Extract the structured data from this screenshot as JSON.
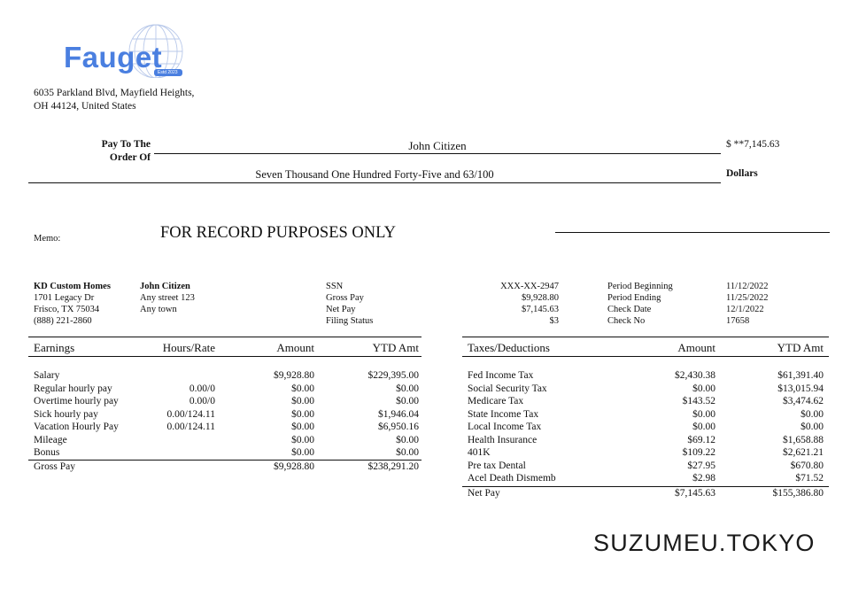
{
  "company": {
    "logo_name": "Fauget",
    "logo_estd": "Estd 2023",
    "address_line1": "6035 Parkland Blvd, Mayfield Heights,",
    "address_line2": "OH 44124, United States"
  },
  "check": {
    "pay_to_label_1": "Pay To The",
    "pay_to_label_2": "Order Of",
    "payee": "John Citizen",
    "amount": "$ **7,145.63",
    "amount_words": "Seven Thousand One Hundred Forty-Five and 63/100",
    "dollars_label": "Dollars",
    "memo_label": "Memo:",
    "memo_text": "FOR RECORD PURPOSES ONLY"
  },
  "employer": {
    "name": "KD Custom Homes",
    "street": "1701 Legacy Dr",
    "city": "Frisco, TX 75034",
    "phone": "(888) 221-2860"
  },
  "employee": {
    "name": "John Citizen",
    "street": "Any street 123",
    "city": "Any town"
  },
  "summary": {
    "labels": [
      "SSN",
      "Gross Pay",
      "Net Pay",
      "Filing Status"
    ],
    "values": [
      "XXX-XX-2947",
      "$9,928.80",
      "$7,145.63",
      "$3"
    ]
  },
  "period": {
    "labels": [
      "Period Beginning",
      "Period Ending",
      "Check Date",
      "Check No"
    ],
    "values": [
      "11/12/2022",
      "11/25/2022",
      "12/1/2022",
      "17658"
    ]
  },
  "earnings": {
    "headers": [
      "Earnings",
      "Hours/Rate",
      "Amount",
      "YTD Amt"
    ],
    "rows": [
      {
        "label": "Salary",
        "rate": "",
        "amount": "$9,928.80",
        "ytd": "$229,395.00"
      },
      {
        "label": "Regular hourly pay",
        "rate": "0.00/0",
        "amount": "$0.00",
        "ytd": "$0.00"
      },
      {
        "label": "Overtime hourly pay",
        "rate": "0.00/0",
        "amount": "$0.00",
        "ytd": "$0.00"
      },
      {
        "label": "Sick hourly pay",
        "rate": "0.00/124.11",
        "amount": "$0.00",
        "ytd": "$1,946.04"
      },
      {
        "label": "Vacation Hourly Pay",
        "rate": "0.00/124.11",
        "amount": "$0.00",
        "ytd": "$6,950.16"
      },
      {
        "label": "Mileage",
        "rate": "",
        "amount": "$0.00",
        "ytd": "$0.00"
      },
      {
        "label": "Bonus",
        "rate": "",
        "amount": "$0.00",
        "ytd": "$0.00"
      }
    ],
    "total": {
      "label": "Gross Pay",
      "amount": "$9,928.80",
      "ytd": "$238,291.20"
    }
  },
  "taxes": {
    "headers": [
      "Taxes/Deductions",
      "Amount",
      "YTD Amt"
    ],
    "rows": [
      {
        "label": "Fed Income Tax",
        "amount": "$2,430.38",
        "ytd": "$61,391.40"
      },
      {
        "label": "Social Security Tax",
        "amount": "$0.00",
        "ytd": "$13,015.94"
      },
      {
        "label": "Medicare Tax",
        "amount": "$143.52",
        "ytd": "$3,474.62"
      },
      {
        "label": "State Income Tax",
        "amount": "$0.00",
        "ytd": "$0.00"
      },
      {
        "label": "Local Income Tax",
        "amount": "$0.00",
        "ytd": "$0.00"
      },
      {
        "label": "Health Insurance",
        "amount": "$69.12",
        "ytd": "$1,658.88"
      },
      {
        "label": "401K",
        "amount": "$109.22",
        "ytd": "$2,621.21"
      },
      {
        "label": "Pre tax Dental",
        "amount": "$27.95",
        "ytd": "$670.80"
      },
      {
        "label": "Acel Death Dismemb",
        "amount": "$2.98",
        "ytd": "$71.52"
      }
    ],
    "total": {
      "label": "Net Pay",
      "amount": "$7,145.63",
      "ytd": "$155,386.80"
    }
  },
  "watermark": "SUZUMEU.TOKYO",
  "colors": {
    "logo": "#4a7fe0",
    "text": "#111111"
  }
}
